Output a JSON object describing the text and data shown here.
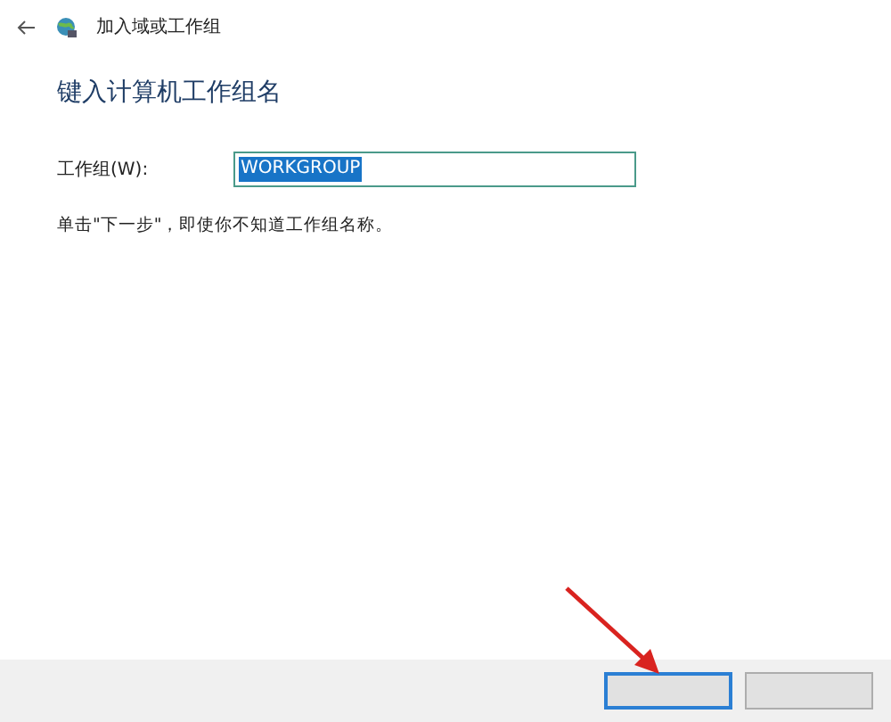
{
  "window": {
    "title": "加入域或工作组"
  },
  "heading": "键入计算机工作组名",
  "workgroup_field": {
    "label": "工作组(W):",
    "value": "WORKGROUP",
    "value_selected": true
  },
  "hint": "单击\"下一步\"，即使你不知道工作组名称。",
  "buttons": [
    {
      "focused": true
    },
    {
      "focused": false
    }
  ]
}
